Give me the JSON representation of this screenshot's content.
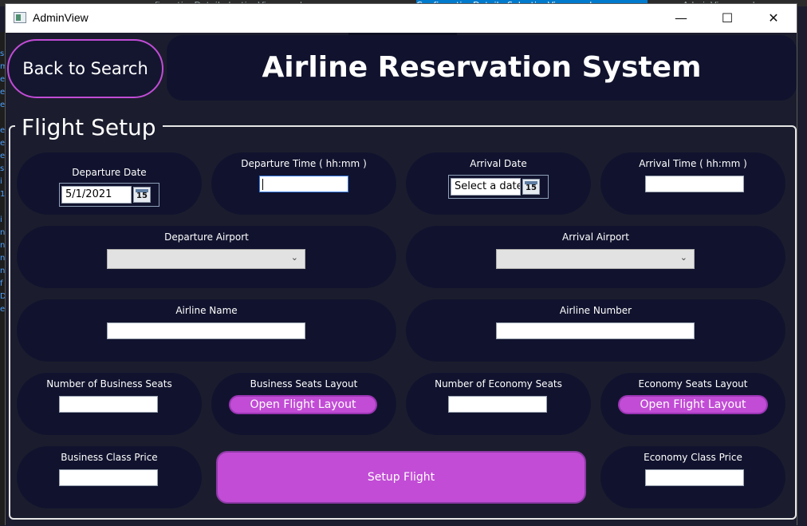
{
  "background_tabs": [
    "onfirmationDetail...lectionView.xaml.cs",
    "ConfirmationDetail...SelectionView.xaml",
    "AdminView.xaml.cs"
  ],
  "window": {
    "title": "AdminView",
    "minimize": "—",
    "maximize": "☐",
    "close": "✕"
  },
  "back_button": "Back to Search",
  "header_title": "Airline Reservation System",
  "group_title": "Flight Setup",
  "fields": {
    "departure_date": {
      "label": "Departure Date",
      "value": "5/1/2021"
    },
    "departure_time": {
      "label": "Departure Time ( hh:mm )",
      "value": ""
    },
    "arrival_date": {
      "label": "Arrival Date",
      "placeholder": "Select a date"
    },
    "arrival_time": {
      "label": "Arrival Time ( hh:mm )",
      "value": ""
    },
    "departure_airport": {
      "label": "Departure Airport",
      "value": ""
    },
    "arrival_airport": {
      "label": "Arrival Airport",
      "value": ""
    },
    "airline_name": {
      "label": "Airline Name",
      "value": ""
    },
    "airline_number": {
      "label": "Airline Number",
      "value": ""
    },
    "business_seats": {
      "label": "Number of Business Seats",
      "value": ""
    },
    "business_layout": {
      "label": "Business Seats Layout",
      "button": "Open Flight Layout"
    },
    "economy_seats": {
      "label": "Number of Economy Seats",
      "value": ""
    },
    "economy_layout": {
      "label": "Economy Seats Layout",
      "button": "Open Flight Layout"
    },
    "business_price": {
      "label": "Business Class Price",
      "value": ""
    },
    "economy_price": {
      "label": "Economy Class Price",
      "value": ""
    }
  },
  "calendar_day": "15",
  "setup_button": "Setup Flight",
  "colors": {
    "accent": "#c24cd6",
    "panel": "#11132e",
    "background": "#1b1d2e"
  }
}
